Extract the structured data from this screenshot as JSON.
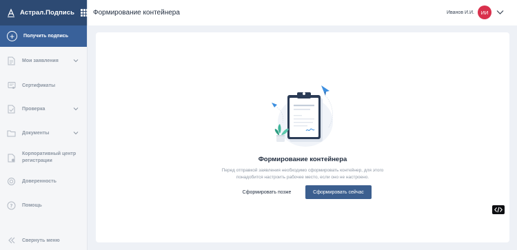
{
  "brand": {
    "title": "Астрал.Подпись",
    "logo_icon": "signature-pen-icon",
    "apps_icon": "apps-grid-icon"
  },
  "sidebar": {
    "primary_action": "Получить подпись",
    "items": [
      {
        "label": "Мои заявления",
        "icon": "document-icon",
        "has_chevron": true
      },
      {
        "label": "Сертификаты",
        "icon": "certificate-icon",
        "has_chevron": false
      },
      {
        "label": "Проверка",
        "icon": "check-document-icon",
        "has_chevron": true
      },
      {
        "label": "Документы",
        "icon": "folder-icon",
        "has_chevron": true
      },
      {
        "label_line1": "Корпоративный центр",
        "label_line2": "регистрации",
        "icon": "corporate-center-icon",
        "has_chevron": false
      },
      {
        "label": "Доверенность",
        "icon": "trust-icon",
        "has_chevron": false
      },
      {
        "label": "Помощь",
        "icon": "help-icon",
        "has_chevron": false
      }
    ],
    "collapse_label": "Свернуть меню"
  },
  "header": {
    "title": "Формирование контейнера",
    "user_name": "Иванов И.И.",
    "avatar_initials": "ИИ"
  },
  "main": {
    "title": "Формирование контейнера",
    "description": "Перед отправкой заявления необходимо сформировать контейнер, для этого понадобится настроить рабочее место, если оно не настроено.",
    "later_label": "Сформировать позже",
    "now_label": "Сформировать сейчас"
  },
  "colors": {
    "brand_bar": "#2d4a73",
    "primary_action_bg": "#39619a",
    "avatar_bg": "#d9304c",
    "primary_button": "#3c5f8f",
    "sidebar_text": "#8c96a3"
  }
}
